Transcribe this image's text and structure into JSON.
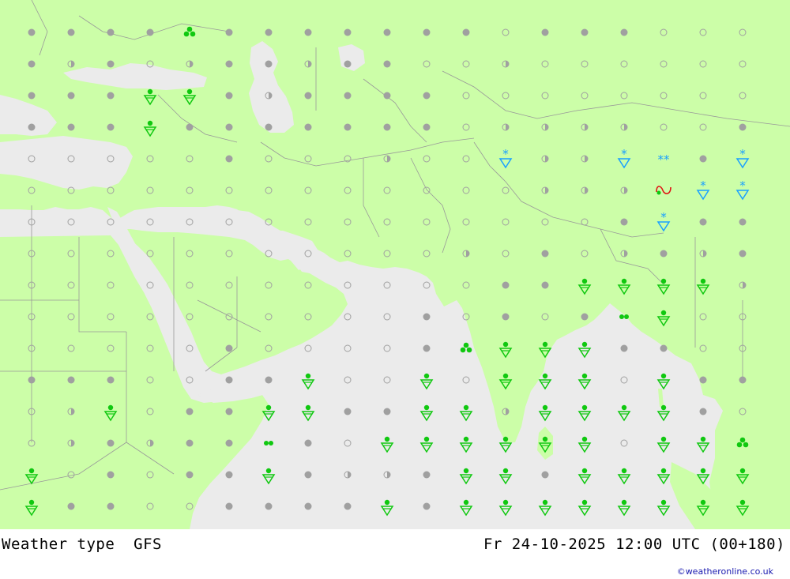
{
  "title": {
    "left": "Weather type  GFS",
    "right": "Fr 24-10-2025 12:00 UTC (00+180)"
  },
  "credit": "©weatheronline.co.uk",
  "colors": {
    "land": "#ccfea8",
    "sea": "#ebebeb",
    "border": "#999999",
    "rain": "#10c810",
    "snow": "#1aa0ff",
    "dot": "#a0a0a0",
    "thunder": "#e01414"
  },
  "grid": {
    "columns": 19,
    "rows": 16,
    "lon_start": 20,
    "lon_step": 5,
    "lat_start": 50,
    "lat_step": -5,
    "legend": "o = clear, half = partly cloudy, dot = overcast"
  },
  "symbols": {
    "rows": [
      "BBBBRBBBBBBBCBBBCCC",
      "BHBCHBBHBBCCHCCCCCC",
      "BBBDDBHBBBBCCCCCCCC",
      "BBBDBBBBBBBCHHHHCCB",
      "CCCCCBCCCHCCSHHSWBS",
      "CCCCCCCCCCCCCHHHFSS",
      "CCCCCCCCCCCCCCCBSBB",
      "CCCCCCCCCCCHCBCHBHB",
      "CCCCCCCCCCCCBBDDDDH",
      "CCCCCCCCCCBCBCBEDCC",
      "CCCCCBCCCCBRDDDBBCC",
      "BBBCCBBDCCDCDDDCDBB",
      "CHDCBBDDBBDDHDDDDBC",
      "CHBHBBEBCDDDDDDCDDR",
      "DCBCBBDBHHBDDBDDDDD",
      "DBBCCBBBBDBDDDDDDDD"
    ]
  }
}
